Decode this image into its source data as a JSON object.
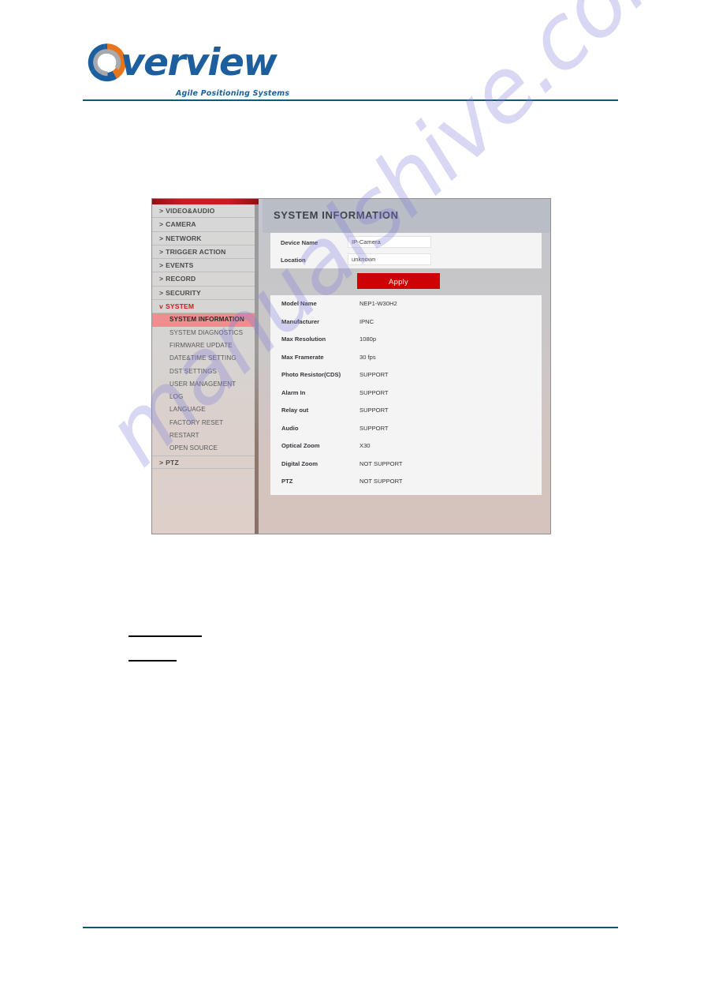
{
  "brand": {
    "name": "verview",
    "tagline": "Agile Positioning Systems",
    "logo_icon": "overview-ring-logo-icon",
    "colors": {
      "blue": "#1d5f9e",
      "orange": "#e8751a",
      "gray": "#a7a9ac",
      "rule": "#0d5a7d"
    }
  },
  "watermark": {
    "text": "manualshive.com"
  },
  "device_ui": {
    "sidebar": {
      "top_menu": [
        {
          "label": "VIDEO&AUDIO",
          "chevron": ">",
          "active": false
        },
        {
          "label": "CAMERA",
          "chevron": ">",
          "active": false
        },
        {
          "label": "NETWORK",
          "chevron": ">",
          "active": false
        },
        {
          "label": "TRIGGER ACTION",
          "chevron": ">",
          "active": false
        },
        {
          "label": "EVENTS",
          "chevron": ">",
          "active": false
        },
        {
          "label": "RECORD",
          "chevron": ">",
          "active": false
        },
        {
          "label": "SECURITY",
          "chevron": ">",
          "active": false
        },
        {
          "label": "SYSTEM",
          "chevron": "v",
          "active": true
        }
      ],
      "sub_menu": [
        {
          "label": "SYSTEM INFORMATION",
          "selected": true
        },
        {
          "label": "SYSTEM DIAGNOSTICS",
          "selected": false
        },
        {
          "label": "FIRMWARE UPDATE",
          "selected": false
        },
        {
          "label": "DATE&TIME SETTING",
          "selected": false
        },
        {
          "label": "DST SETTINGS",
          "selected": false
        },
        {
          "label": "USER MANAGEMENT",
          "selected": false
        },
        {
          "label": "LOG",
          "selected": false
        },
        {
          "label": "LANGUAGE",
          "selected": false
        },
        {
          "label": "FACTORY RESET",
          "selected": false
        },
        {
          "label": "RESTART",
          "selected": false
        },
        {
          "label": "OPEN SOURCE",
          "selected": false
        }
      ],
      "bottom_menu": [
        {
          "label": "PTZ",
          "chevron": ">",
          "active": false
        }
      ],
      "accent_color": "#d11a1d",
      "selected_color": "#ef8e8e"
    },
    "main": {
      "title": "SYSTEM INFORMATION",
      "form": {
        "fields": [
          {
            "label": "Device Name",
            "value": "IP-Camera",
            "placeholder": "IP-Camera"
          },
          {
            "label": "Location",
            "value": "unknown",
            "placeholder": "unknown"
          }
        ],
        "apply_label": "Apply",
        "apply_color": "#cc0204"
      },
      "info": {
        "rows": [
          {
            "key": "Model Name",
            "value": "NEP1-W30H2"
          },
          {
            "key": "Manufacturer",
            "value": "IPNC"
          },
          {
            "key": "Max Resolution",
            "value": "1080p"
          },
          {
            "key": "Max Framerate",
            "value": "30 fps"
          },
          {
            "key": "Photo Resistor(CDS)",
            "value": "SUPPORT"
          },
          {
            "key": "Alarm In",
            "value": "SUPPORT"
          },
          {
            "key": "Relay out",
            "value": "SUPPORT"
          },
          {
            "key": "Audio",
            "value": "SUPPORT"
          },
          {
            "key": "Optical Zoom",
            "value": "X30"
          },
          {
            "key": "Digital Zoom",
            "value": "NOT SUPPORT"
          },
          {
            "key": "PTZ",
            "value": "NOT SUPPORT"
          }
        ]
      }
    }
  }
}
